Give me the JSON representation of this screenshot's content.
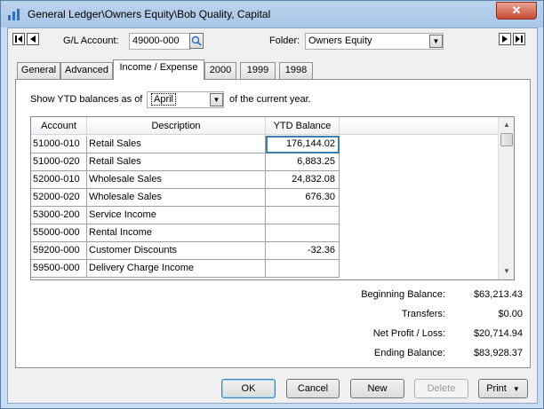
{
  "window": {
    "title": "General Ledger\\Owners Equity\\Bob Quality, Capital",
    "close_glyph": "✕"
  },
  "header": {
    "gl_account_label": "G/L Account:",
    "gl_account_value": "49000-000",
    "folder_label": "Folder:",
    "folder_value": "Owners Equity"
  },
  "tabs": [
    "General",
    "Advanced",
    "Income / Expense",
    "2000",
    "1999",
    "1998"
  ],
  "active_tab": "Income / Expense",
  "ytd": {
    "prefix": "Show YTD balances as of",
    "month": "April",
    "suffix": "of the current year."
  },
  "table": {
    "columns": [
      "Account",
      "Description",
      "YTD Balance"
    ],
    "rows": [
      {
        "account": "51000-010",
        "description": "Retail Sales",
        "ytd": "176,144.02"
      },
      {
        "account": "51000-020",
        "description": "Retail Sales",
        "ytd": "6,883.25"
      },
      {
        "account": "52000-010",
        "description": "Wholesale Sales",
        "ytd": "24,832.08"
      },
      {
        "account": "52000-020",
        "description": "Wholesale Sales",
        "ytd": "676.30"
      },
      {
        "account": "53000-200",
        "description": "Service Income",
        "ytd": ""
      },
      {
        "account": "55000-000",
        "description": "Rental Income",
        "ytd": ""
      },
      {
        "account": "59200-000",
        "description": "Customer Discounts",
        "ytd": "-32.36"
      },
      {
        "account": "59500-000",
        "description": "Delivery Charge Income",
        "ytd": ""
      }
    ]
  },
  "totals": [
    {
      "label": "Beginning Balance:",
      "value": "$63,213.43"
    },
    {
      "label": "Transfers:",
      "value": "$0.00"
    },
    {
      "label": "Net Profit / Loss:",
      "value": "$20,714.94"
    },
    {
      "label": "Ending Balance:",
      "value": "$83,928.37"
    }
  ],
  "buttons": {
    "ok": "OK",
    "cancel": "Cancel",
    "new": "New",
    "delete": "Delete",
    "print": "Print"
  },
  "colors": {
    "selection_border": "#3c7fb1",
    "title_bar": "#bcd3ec",
    "close_button": "#c74c35"
  }
}
